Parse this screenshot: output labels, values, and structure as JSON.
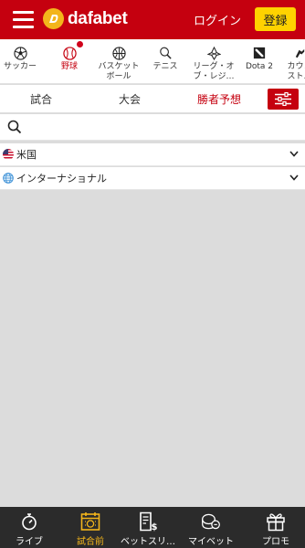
{
  "header": {
    "brand": "dafabet",
    "login_label": "ログイン",
    "register_label": "登録",
    "accent_color": "#c5000f",
    "register_color": "#ffd200"
  },
  "sports": [
    {
      "label": "サッカー",
      "icon": "soccer-ball-icon",
      "active": false
    },
    {
      "label": "野球",
      "icon": "baseball-icon",
      "active": true,
      "badge": true
    },
    {
      "label": "バスケット\nボール",
      "icon": "basketball-icon",
      "active": false
    },
    {
      "label": "テニス",
      "icon": "tennis-racket-icon",
      "active": false
    },
    {
      "label": "リーグ・オ\nブ・レジ…",
      "icon": "league-of-legends-icon",
      "active": false
    },
    {
      "label": "Dota 2",
      "icon": "dota2-icon",
      "active": false
    },
    {
      "label": "カウン\nスト…",
      "icon": "counter-strike-icon",
      "active": false
    }
  ],
  "tabs": [
    {
      "label": "試合"
    },
    {
      "label": "大会"
    },
    {
      "label": "勝者予想"
    }
  ],
  "search": {
    "placeholder": ""
  },
  "regions": [
    {
      "name": "米国",
      "icon": "us-flag-icon"
    },
    {
      "name": "インターナショナル",
      "icon": "globe-icon"
    }
  ],
  "bottom_nav": [
    {
      "label": "ライブ",
      "icon": "stopwatch-icon",
      "active": false
    },
    {
      "label": "試合前",
      "icon": "calendar-icon",
      "active": true
    },
    {
      "label": "ベットスリ…",
      "icon": "bet-slip-icon",
      "active": false
    },
    {
      "label": "マイベット",
      "icon": "coins-icon",
      "active": false
    },
    {
      "label": "プロモ",
      "icon": "gift-icon",
      "active": false
    }
  ]
}
